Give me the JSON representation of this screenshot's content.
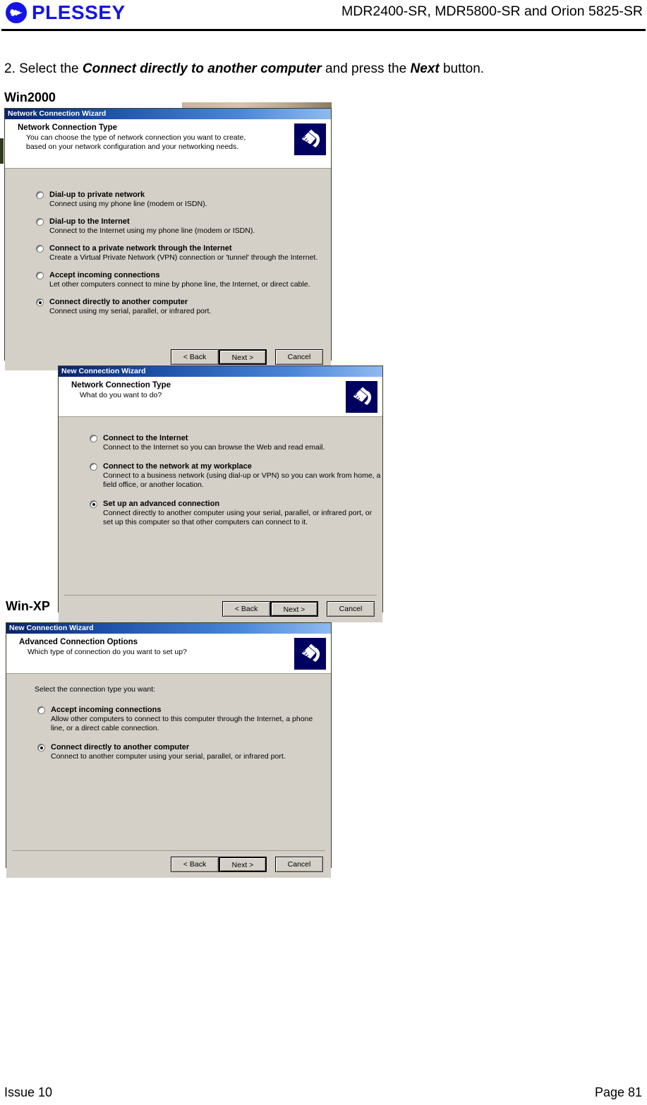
{
  "header": {
    "logo_text": "PLESSEY",
    "logo_icon": "plessey-waveform-circle-logo",
    "title": "MDR2400-SR, MDR5800-SR and Orion 5825-SR"
  },
  "content": {
    "step_prefix": "2. Select the ",
    "step_bold1": "Connect directly to another computer",
    "step_middle": " and press the ",
    "step_bold2": "Next",
    "step_suffix": " button.",
    "os_label_win2000": "Win2000",
    "os_label_winxp": "Win-XP"
  },
  "dialog1": {
    "title": "Network Connection Wizard",
    "banner_head": "Network Connection Type",
    "banner_sub": "You can choose the type of network connection you want to create, based on your network configuration and your networking needs.",
    "icon": "network-plug-icon",
    "options": [
      {
        "label": "Dial-up to private network",
        "desc": "Connect using my phone line (modem or ISDN).",
        "selected": false
      },
      {
        "label": "Dial-up to the Internet",
        "desc": "Connect to the Internet using my phone line (modem or ISDN).",
        "selected": false
      },
      {
        "label": "Connect to a private network through the Internet",
        "desc": "Create a Virtual Private Network (VPN) connection or 'tunnel' through the Internet.",
        "selected": false
      },
      {
        "label": "Accept incoming connections",
        "desc": "Let other computers connect to mine by phone line, the Internet, or direct cable.",
        "selected": false
      },
      {
        "label": "Connect directly to another computer",
        "desc": "Connect using my serial, parallel, or infrared port.",
        "selected": true
      }
    ],
    "buttons": {
      "back": "< Back",
      "next": "Next >",
      "cancel": "Cancel"
    }
  },
  "dialog2": {
    "title": "New Connection Wizard",
    "banner_head": "Network Connection Type",
    "banner_sub": "What do you want to do?",
    "icon": "network-plug-icon",
    "options": [
      {
        "label": "Connect to the Internet",
        "desc": "Connect to the Internet so you can browse the Web and read email.",
        "selected": false
      },
      {
        "label": "Connect to the network at my workplace",
        "desc": "Connect to a business network (using dial-up or VPN) so you can work from home, a field office, or another location.",
        "selected": false
      },
      {
        "label": "Set up an advanced connection",
        "desc": "Connect directly to another computer using your serial, parallel, or infrared port, or set up this computer so that other computers can connect to it.",
        "selected": true
      }
    ],
    "buttons": {
      "back": "< Back",
      "next": "Next >",
      "cancel": "Cancel"
    }
  },
  "dialog3": {
    "title": "New Connection Wizard",
    "banner_head": "Advanced Connection Options",
    "banner_sub": "Which type of connection do you want to set up?",
    "icon": "network-plug-icon",
    "prompt": "Select the connection type you want:",
    "options": [
      {
        "label": "Accept incoming connections",
        "desc": "Allow other computers to connect to this computer through the Internet, a phone line, or a direct cable connection.",
        "selected": false
      },
      {
        "label": "Connect directly to another computer",
        "desc": "Connect to another computer using your serial, parallel, or infrared port.",
        "selected": true
      }
    ],
    "buttons": {
      "back": "< Back",
      "next": "Next >",
      "cancel": "Cancel"
    }
  },
  "footer": {
    "issue": "Issue 10",
    "page": "Page 81"
  }
}
